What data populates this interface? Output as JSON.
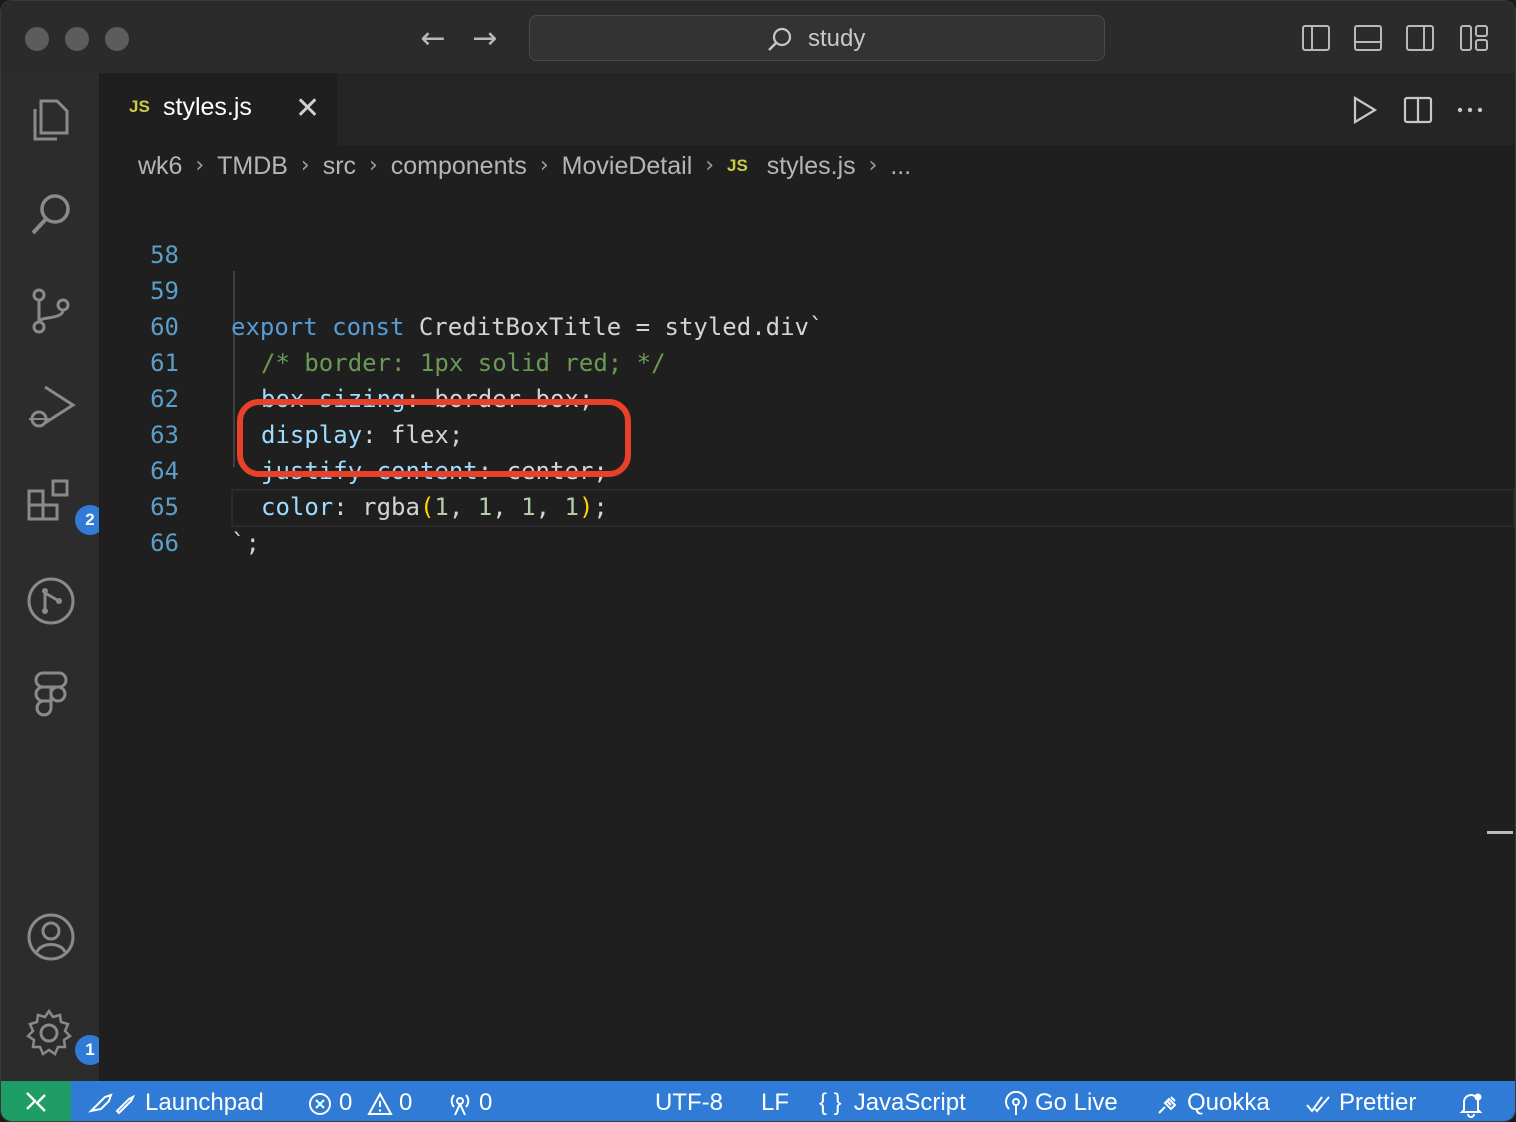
{
  "titlebar": {
    "search_text": "study",
    "back_icon": "arrow-left-icon",
    "forward_icon": "arrow-right-icon"
  },
  "activity_bar": {
    "items": [
      {
        "icon": "files-icon"
      },
      {
        "icon": "search-icon"
      },
      {
        "icon": "source-control-icon"
      },
      {
        "icon": "run-debug-icon"
      },
      {
        "icon": "extensions-icon",
        "badge": "2"
      },
      {
        "icon": "git-graph-icon"
      },
      {
        "icon": "figma-icon"
      },
      {
        "icon": "account-icon"
      },
      {
        "icon": "settings-gear-icon",
        "badge": "1"
      }
    ]
  },
  "tab": {
    "file_type": "JS",
    "name": "styles.js",
    "close": "✕"
  },
  "breadcrumbs": [
    "wk6",
    "TMDB",
    "src",
    "components",
    "MovieDetail",
    "styles.js",
    "..."
  ],
  "breadcrumb_file_type": "JS",
  "editor": {
    "line_numbers": [
      "58",
      "59",
      "60",
      "61",
      "62",
      "63",
      "64",
      "65",
      "66"
    ],
    "code_lines": {
      "l59_kw1": "export",
      "l59_kw2": "const",
      "l59_rest": "CreditBoxTitle = styled.div`",
      "l60": "/* border: 1px solid red; */",
      "l61_prop": "box-sizing",
      "l61_val": ": border-box;",
      "l62_prop": "display",
      "l62_val": ": flex;",
      "l63_prop": "justify-content",
      "l63_val": ": center;",
      "l64_prop": "color",
      "l64_colon": ": rgba",
      "l64_open": "(",
      "l64_n1": "1",
      "l64_c1": ", ",
      "l64_n2": "1",
      "l64_c2": ", ",
      "l64_n3": "1",
      "l64_c3": ", ",
      "l64_n4": "1",
      "l64_close": ")",
      "l64_end": ";",
      "l65": "`;"
    },
    "highlight_color": "#e9402a"
  },
  "statusbar": {
    "launchpad": "Launchpad",
    "errors": "0",
    "warnings": "0",
    "ports": "0",
    "encoding": "UTF-8",
    "eol": "LF",
    "language_icon": "{ }",
    "language": "JavaScript",
    "golive": "Go Live",
    "quokka": "Quokka",
    "prettier": "Prettier",
    "accent": "#2f7bd6",
    "remote_color": "#1e9d66"
  }
}
